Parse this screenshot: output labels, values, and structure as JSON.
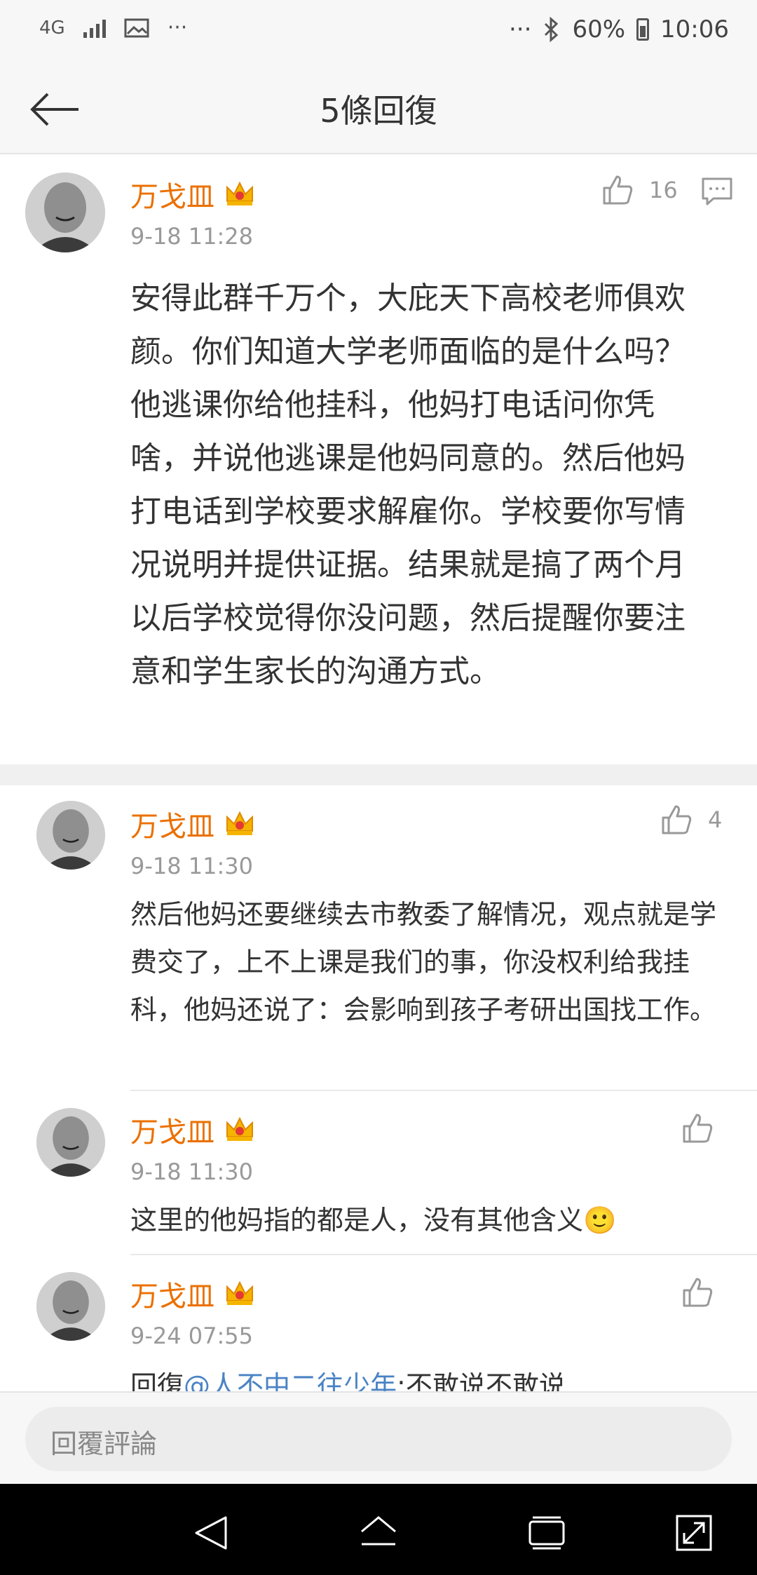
{
  "status_bar": {
    "network": "4G",
    "battery": "60%",
    "time": "10:06",
    "more_left": "···",
    "more_right": "···"
  },
  "header": {
    "title": "5條回復",
    "back_icon": "back-arrow-icon"
  },
  "main_comment": {
    "user": "万戈皿",
    "time": "9-18 11:28",
    "likes": "16",
    "text": "安得此群千万个，大庇天下高校老师俱欢颜。你们知道大学老师面临的是什么吗？他逃课你给他挂科，他妈打电话问你凭啥，并说他逃课是他妈同意的。然后他妈打电话到学校要求解雇你。学校要你写情况说明并提供证据。结果就是搞了两个月以后学校觉得你没问题，然后提醒你要注意和学生家长的沟通方式。"
  },
  "replies": [
    {
      "user": "万戈皿",
      "time": "9-18 11:30",
      "likes": "4",
      "text": "然后他妈还要继续去市教委了解情况，观点就是学费交了，上不上课是我们的事，你没权利给我挂科，他妈还说了：会影响到孩子考研出国找工作。"
    },
    {
      "user": "万戈皿",
      "time": "9-18 11:30",
      "likes": "",
      "text": "这里的他妈指的都是人，没有其他含义🙂"
    },
    {
      "user": "万戈皿",
      "time": "9-24 07:55",
      "likes": "",
      "prefix": "回復",
      "mention": "@人不中二往少年",
      "text": ":不敢说不敢说"
    }
  ],
  "input": {
    "placeholder": "回覆評論"
  },
  "colors": {
    "username": "#eb7000",
    "mention": "#4a83c4",
    "muted": "#999999"
  }
}
